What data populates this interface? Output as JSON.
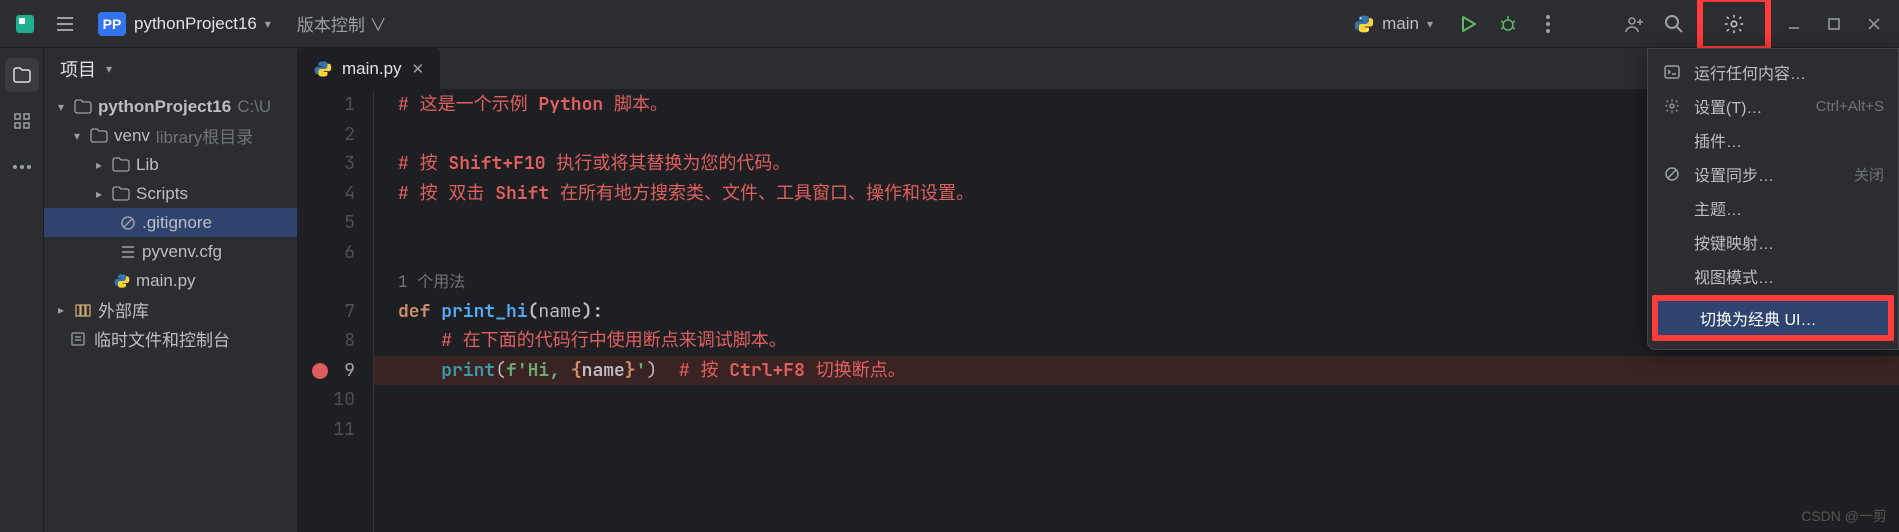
{
  "topbar": {
    "project_name": "pythonProject16",
    "vcs_label": "版本控制 ∨",
    "run_config": "main"
  },
  "panel": {
    "title": "项目"
  },
  "tree": {
    "root": "pythonProject16",
    "root_hint": "C:\\U",
    "venv": "venv",
    "venv_hint": "library根目录",
    "lib": "Lib",
    "scripts": "Scripts",
    "gitignore": ".gitignore",
    "pyvenv": "pyvenv.cfg",
    "main": "main.py",
    "external": "外部库",
    "scratches": "临时文件和控制台"
  },
  "tab": {
    "label": "main.py"
  },
  "gutter": {
    "lines": [
      "1",
      "2",
      "3",
      "4",
      "5",
      "6",
      "",
      "7",
      "8",
      "9",
      "10",
      "11"
    ]
  },
  "code": {
    "l1": "# 这是一个示例 ",
    "l1b": "Python",
    "l1c": " 脚本。",
    "l3a": "# 按 ",
    "l3b": "Shift+F10",
    "l3c": " 执行或将其替换为您的代码。",
    "l4a": "# 按 双击 ",
    "l4b": "Shift",
    "l4c": " 在所有地方搜索类、文件、工具窗口、操作和设置。",
    "usage": "1 个用法",
    "l7a": "def ",
    "l7b": "print_hi",
    "l7c": "(",
    "l7d": "name",
    "l7e": "):",
    "l8": "# 在下面的代码行中使用断点来调试脚本。",
    "l9a": "print",
    "l9b": "(",
    "l9c": "f'Hi, ",
    "l9d": "{",
    "l9e": "name",
    "l9f": "}",
    "l9g": "'",
    "l9h": ")  ",
    "l9i": "# 按 ",
    "l9j": "Ctrl+F8",
    "l9k": " 切换断点。"
  },
  "menu": {
    "run_anything": "运行任何内容…",
    "settings": "设置(T)…",
    "settings_hint": "Ctrl+Alt+S",
    "plugins": "插件…",
    "sync": "设置同步…",
    "sync_hint": "关闭",
    "theme": "主题…",
    "keymap": "按键映射…",
    "viewmode": "视图模式…",
    "classic_ui": "切换为经典 UI…"
  },
  "watermark": "CSDN @一剪"
}
